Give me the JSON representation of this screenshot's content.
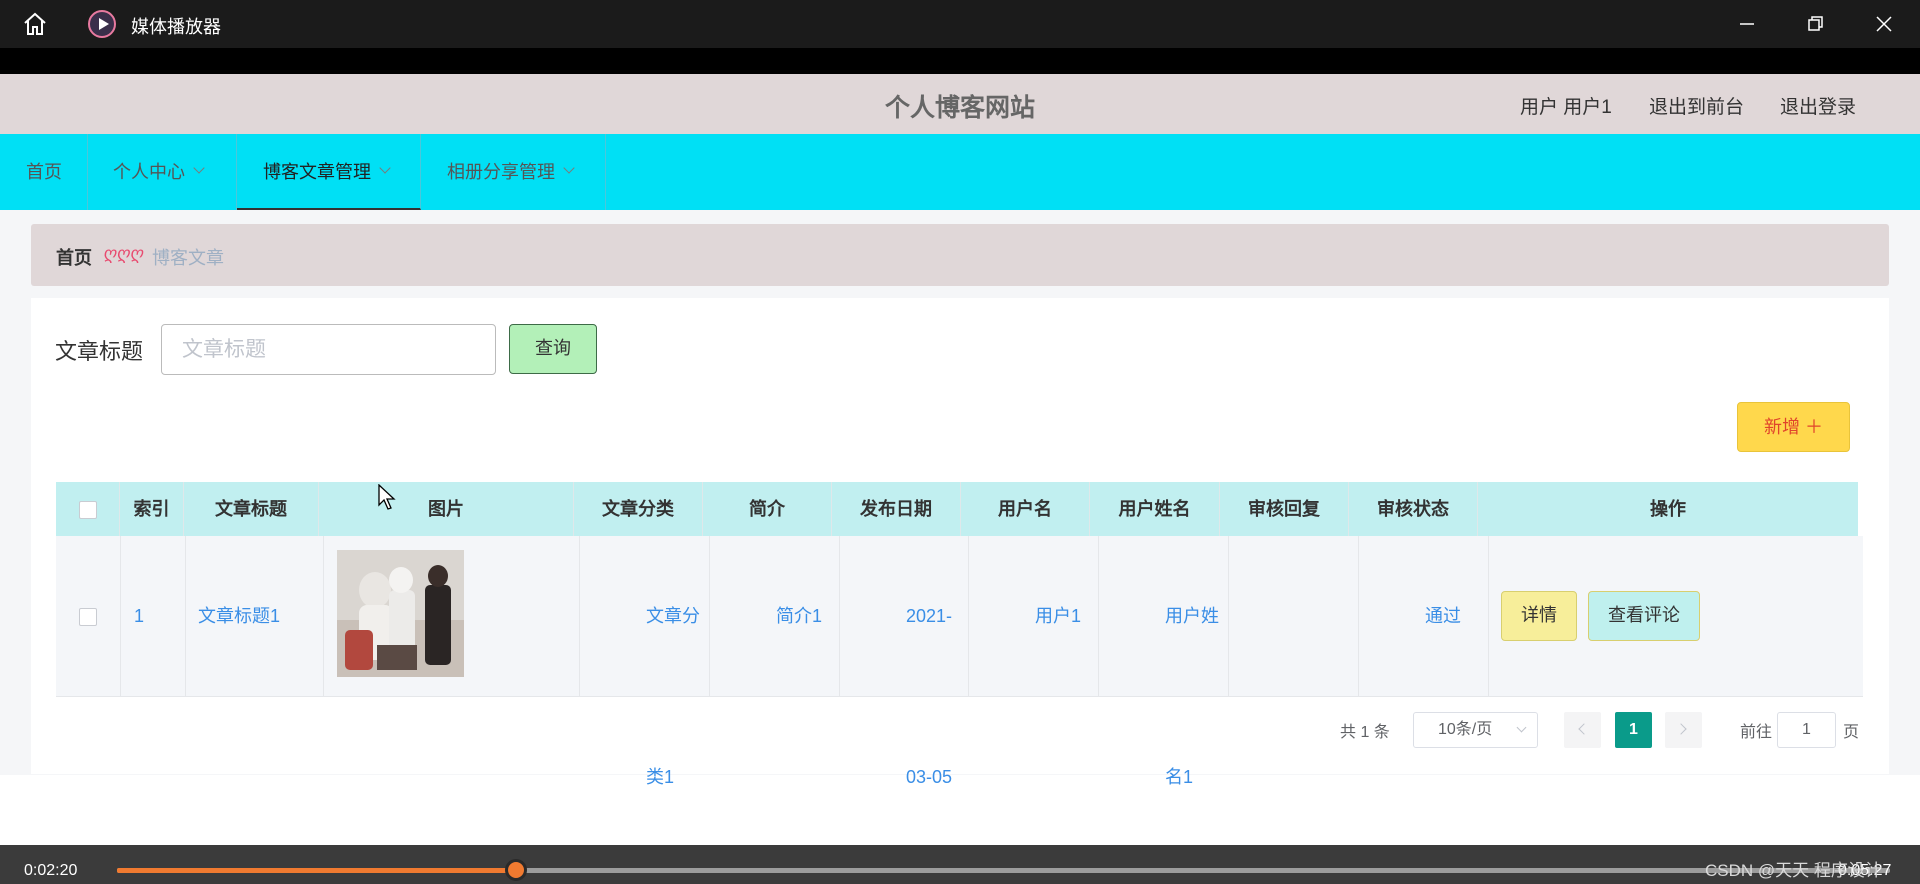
{
  "player": {
    "app_title": "媒体播放器",
    "time_current": "0:02:20",
    "time_total": "0:05:27",
    "progress": 0.225,
    "watermark": "CSDN @天天 程序设计",
    "accent": "#f07a30"
  },
  "header": {
    "site_title": "个人博客网站",
    "user_label": "用户 用户1",
    "front_link": "退出到前台",
    "logout_link": "退出登录"
  },
  "nav": {
    "items": [
      {
        "label": "首页"
      },
      {
        "label": "个人中心"
      },
      {
        "label": "博客文章管理"
      },
      {
        "label": "相册分享管理"
      }
    ],
    "color": "#00e0f5"
  },
  "breadcrumb": {
    "home": "首页",
    "separator": "ღღღ",
    "current": "博客文章"
  },
  "search": {
    "label": "文章标题",
    "placeholder": "文章标题",
    "button": "查询"
  },
  "add_button": "新增 ＋",
  "table": {
    "columns": [
      "索引",
      "文章标题",
      "图片",
      "文章分类",
      "简介",
      "发布日期",
      "用户名",
      "用户姓名",
      "审核回复",
      "审核状态",
      "操作"
    ],
    "rows": [
      {
        "index": "1",
        "title": "文章标题1",
        "category": "文章分类1",
        "intro": "简介1",
        "date": "2021-03-05",
        "username": "用户1",
        "name": "用户姓名1",
        "reply": "",
        "status": "通过",
        "detail_btn": "详情",
        "comment_btn": "查看评论"
      }
    ]
  },
  "pagination": {
    "total": "共 1 条",
    "page_size": "10条/页",
    "current": "1",
    "goto": "前往",
    "jump_value": "1",
    "page_unit": "页"
  }
}
